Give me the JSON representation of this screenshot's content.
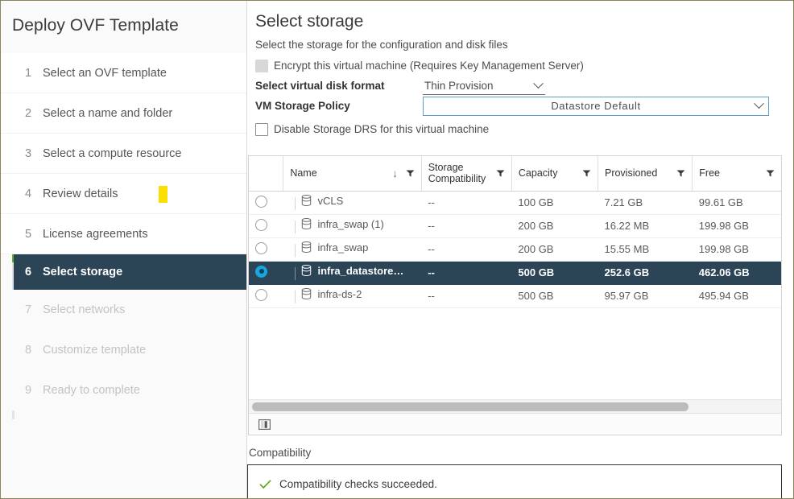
{
  "wizard": {
    "title": "Deploy OVF Template",
    "steps": [
      {
        "num": "1",
        "label": "Select an OVF template",
        "state": "done"
      },
      {
        "num": "2",
        "label": "Select a name and folder",
        "state": "done"
      },
      {
        "num": "3",
        "label": "Select a compute resource",
        "state": "done"
      },
      {
        "num": "4",
        "label": "Review details",
        "state": "done",
        "marker": true
      },
      {
        "num": "5",
        "label": "License agreements",
        "state": "done"
      },
      {
        "num": "6",
        "label": "Select storage",
        "state": "active"
      },
      {
        "num": "7",
        "label": "Select networks",
        "state": "future"
      },
      {
        "num": "8",
        "label": "Customize template",
        "state": "future"
      },
      {
        "num": "9",
        "label": "Ready to complete",
        "state": "future"
      }
    ]
  },
  "page": {
    "title": "Select storage",
    "subtitle": "Select the storage for the configuration and disk files"
  },
  "form": {
    "encrypt_label": "Encrypt this virtual machine (Requires Key Management Server)",
    "encrypt_checked": false,
    "encrypt_disabled": true,
    "disk_format_label": "Select virtual disk format",
    "disk_format_value": "Thin Provision",
    "storage_policy_label": "VM Storage Policy",
    "storage_policy_value": "Datastore Default",
    "disable_drs_label": "Disable Storage DRS for this virtual machine",
    "disable_drs_checked": false
  },
  "table": {
    "columns": [
      {
        "key": "radio",
        "label": ""
      },
      {
        "key": "name",
        "label": "Name",
        "sorted": "asc",
        "filter": true
      },
      {
        "key": "storage_compat",
        "label": "Storage Compatibility",
        "filter": true
      },
      {
        "key": "capacity",
        "label": "Capacity",
        "filter": true
      },
      {
        "key": "provisioned",
        "label": "Provisioned",
        "filter": true
      },
      {
        "key": "free",
        "label": "Free",
        "filter": true
      }
    ],
    "rows": [
      {
        "name": "vCLS",
        "storage_compat": "--",
        "capacity": "100 GB",
        "provisioned": "7.21 GB",
        "free": "99.61 GB",
        "selected": false
      },
      {
        "name": "infra_swap (1)",
        "storage_compat": "--",
        "capacity": "200 GB",
        "provisioned": "16.22 MB",
        "free": "199.98 GB",
        "selected": false
      },
      {
        "name": "infra_swap",
        "storage_compat": "--",
        "capacity": "200 GB",
        "provisioned": "15.55 MB",
        "free": "199.98 GB",
        "selected": false
      },
      {
        "name": "infra_datastore…",
        "storage_compat": "--",
        "capacity": "500 GB",
        "provisioned": "252.6 GB",
        "free": "462.06 GB",
        "selected": true
      },
      {
        "name": "infra-ds-2",
        "storage_compat": "--",
        "capacity": "500 GB",
        "provisioned": "95.97 GB",
        "free": "495.94 GB",
        "selected": false
      }
    ],
    "scroll_thumb_percent": 83
  },
  "compatibility": {
    "label": "Compatibility",
    "message": "Compatibility checks succeeded."
  },
  "colors": {
    "accent_green": "#5eb715",
    "active_step_bg": "#2b4456",
    "radio_selected": "#17a6e0",
    "marker_yellow": "#f9e000",
    "focus_border": "#5c9fc4",
    "success_green": "#60a917"
  }
}
